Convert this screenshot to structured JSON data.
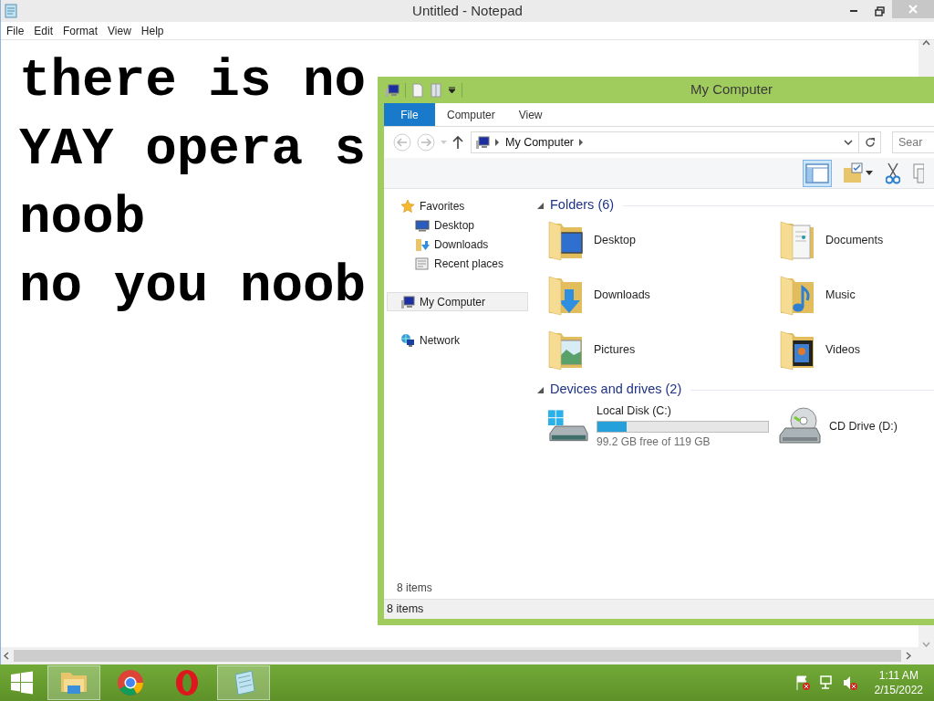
{
  "notepad": {
    "title": "Untitled - Notepad",
    "menu": [
      "File",
      "Edit",
      "Format",
      "View",
      "Help"
    ],
    "lines": [
      "there is no",
      "YAY opera s",
      "noob",
      "no you noob"
    ]
  },
  "explorer": {
    "title": "My Computer",
    "tabs": [
      {
        "label": "File",
        "selected": true
      },
      {
        "label": "Computer",
        "selected": false
      },
      {
        "label": "View",
        "selected": false
      }
    ],
    "address": "My Computer",
    "search": {
      "placeholder": "Sear"
    },
    "toolbar": [
      {
        "kind": "preview-pane",
        "on": true
      },
      {
        "kind": "new-folder",
        "on": false
      },
      {
        "kind": "cut",
        "on": false
      },
      {
        "kind": "copy",
        "on": false
      }
    ],
    "nav": [
      {
        "label": "Favorites",
        "kind": "star",
        "selected": false,
        "children": [
          {
            "label": "Desktop",
            "kind": "monitor",
            "selected": false
          },
          {
            "label": "Downloads",
            "kind": "downloads",
            "selected": false
          },
          {
            "label": "Recent places",
            "kind": "recent",
            "selected": false
          }
        ]
      },
      {
        "label": "My Computer",
        "kind": "computer",
        "selected": true
      },
      {
        "label": "Network",
        "kind": "network",
        "selected": false
      }
    ],
    "groups": [
      {
        "title": "Folders (6)",
        "items": [
          {
            "label": "Desktop",
            "kind": "desktop"
          },
          {
            "label": "Documents",
            "kind": "documents"
          },
          {
            "label": "Downloads",
            "kind": "downloads"
          },
          {
            "label": "Music",
            "kind": "music"
          },
          {
            "label": "Pictures",
            "kind": "pictures"
          },
          {
            "label": "Videos",
            "kind": "videos"
          }
        ]
      },
      {
        "title": "Devices and drives (2)",
        "items": [
          {
            "label": "Local Disk (C:)",
            "kind": "disk",
            "level": 0.17,
            "free": "99.2 GB free of 119 GB"
          },
          {
            "label": "CD Drive (D:)",
            "kind": "cd"
          }
        ]
      }
    ],
    "item_count": "8 items",
    "status": "8 items"
  },
  "taskbar": {
    "apps": [
      {
        "kind": "explorer",
        "selected": true
      },
      {
        "kind": "browser",
        "selected": false
      },
      {
        "kind": "opera",
        "selected": false
      },
      {
        "kind": "notepad",
        "selected": true
      }
    ],
    "time": "1:11 AM",
    "date": "2/15/2022"
  }
}
